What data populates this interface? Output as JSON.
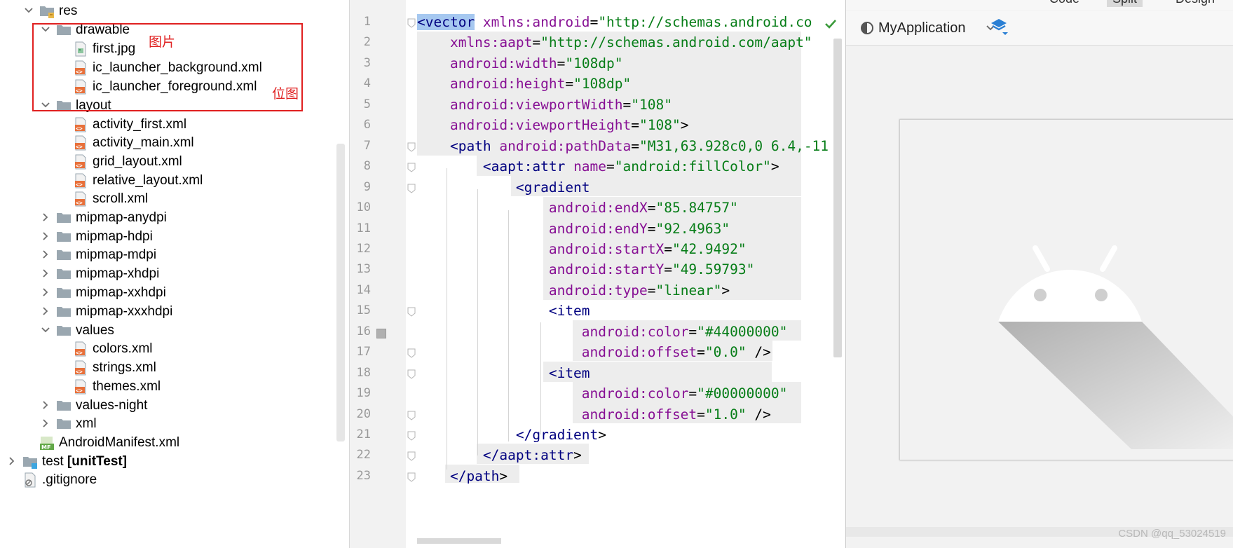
{
  "tree": {
    "rows": [
      {
        "label": "res",
        "bold": "",
        "icon": "resource-folder-icon",
        "expanded": true
      },
      {
        "label": "drawable",
        "bold": "",
        "icon": "folder-icon",
        "expanded": true
      },
      {
        "label": "first.jpg",
        "bold": "",
        "icon": "image-file-icon"
      },
      {
        "label": "ic_launcher_background.xml",
        "bold": "",
        "icon": "xml-file-icon"
      },
      {
        "label": "ic_launcher_foreground.xml",
        "bold": "",
        "icon": "xml-file-icon"
      },
      {
        "label": "layout",
        "bold": "",
        "icon": "folder-icon",
        "expanded": true
      },
      {
        "label": "activity_first.xml",
        "bold": "",
        "icon": "xml-file-icon"
      },
      {
        "label": "activity_main.xml",
        "bold": "",
        "icon": "xml-file-icon"
      },
      {
        "label": "grid_layout.xml",
        "bold": "",
        "icon": "xml-file-icon"
      },
      {
        "label": "relative_layout.xml",
        "bold": "",
        "icon": "xml-file-icon"
      },
      {
        "label": "scroll.xml",
        "bold": "",
        "icon": "xml-file-icon"
      },
      {
        "label": "mipmap-anydpi",
        "bold": "",
        "icon": "folder-icon",
        "expanded": false
      },
      {
        "label": "mipmap-hdpi",
        "bold": "",
        "icon": "folder-icon",
        "expanded": false
      },
      {
        "label": "mipmap-mdpi",
        "bold": "",
        "icon": "folder-icon",
        "expanded": false
      },
      {
        "label": "mipmap-xhdpi",
        "bold": "",
        "icon": "folder-icon",
        "expanded": false
      },
      {
        "label": "mipmap-xxhdpi",
        "bold": "",
        "icon": "folder-icon",
        "expanded": false
      },
      {
        "label": "mipmap-xxxhdpi",
        "bold": "",
        "icon": "folder-icon",
        "expanded": false
      },
      {
        "label": "values",
        "bold": "",
        "icon": "folder-icon",
        "expanded": true
      },
      {
        "label": "colors.xml",
        "bold": "",
        "icon": "xml-file-icon"
      },
      {
        "label": "strings.xml",
        "bold": "",
        "icon": "xml-file-icon"
      },
      {
        "label": "themes.xml",
        "bold": "",
        "icon": "xml-file-icon"
      },
      {
        "label": "values-night",
        "bold": "",
        "icon": "folder-icon",
        "expanded": false
      },
      {
        "label": "xml",
        "bold": "",
        "icon": "folder-icon",
        "expanded": false
      },
      {
        "label": "AndroidManifest.xml",
        "bold": "",
        "icon": "manifest-file-icon"
      },
      {
        "label": "test ",
        "bold": "[unitTest]",
        "icon": "test-folder-icon",
        "expanded": false
      },
      {
        "label": ".gitignore",
        "bold": "",
        "icon": "gitignore-file-icon"
      }
    ],
    "annotations": {
      "image_note": "图片",
      "vector_note": "位图"
    }
  },
  "editor": {
    "lines": [
      {
        "n": "1",
        "tokens": [
          {
            "t": "<vector",
            "c": "tagsel"
          },
          {
            "t": " xmlns:android",
            "c": "attr"
          },
          {
            "t": "=",
            "c": "punc"
          },
          {
            "t": "\"http://schemas.android.co",
            "c": "val"
          }
        ]
      },
      {
        "n": "2",
        "tokens": [
          {
            "t": "    xmlns:aapt",
            "c": "attr"
          },
          {
            "t": "=",
            "c": "punc"
          },
          {
            "t": "\"http://schemas.android.com/aapt\"",
            "c": "val"
          }
        ]
      },
      {
        "n": "3",
        "tokens": [
          {
            "t": "    android:width",
            "c": "attr"
          },
          {
            "t": "=",
            "c": "punc"
          },
          {
            "t": "\"108dp\"",
            "c": "val"
          }
        ]
      },
      {
        "n": "4",
        "tokens": [
          {
            "t": "    android:height",
            "c": "attr"
          },
          {
            "t": "=",
            "c": "punc"
          },
          {
            "t": "\"108dp\"",
            "c": "val"
          }
        ]
      },
      {
        "n": "5",
        "tokens": [
          {
            "t": "    android:viewportWidth",
            "c": "attr"
          },
          {
            "t": "=",
            "c": "punc"
          },
          {
            "t": "\"108\"",
            "c": "val"
          }
        ]
      },
      {
        "n": "6",
        "tokens": [
          {
            "t": "    android:viewportHeight",
            "c": "attr"
          },
          {
            "t": "=",
            "c": "punc"
          },
          {
            "t": "\"108\"",
            "c": "val"
          },
          {
            "t": ">",
            "c": "punc"
          }
        ]
      },
      {
        "n": "7",
        "tokens": [
          {
            "t": "    <path",
            "c": "tag"
          },
          {
            "t": " android:pathData",
            "c": "attr"
          },
          {
            "t": "=",
            "c": "punc"
          },
          {
            "t": "\"M31,63.928c0,0 6.4,-11",
            "c": "val"
          }
        ]
      },
      {
        "n": "8",
        "tokens": [
          {
            "t": "        <aapt:attr",
            "c": "tag"
          },
          {
            "t": " name",
            "c": "attr"
          },
          {
            "t": "=",
            "c": "punc"
          },
          {
            "t": "\"android:fillColor\"",
            "c": "val"
          },
          {
            "t": ">",
            "c": "punc"
          }
        ]
      },
      {
        "n": "9",
        "tokens": [
          {
            "t": "            <gradient",
            "c": "tag"
          }
        ]
      },
      {
        "n": "10",
        "tokens": [
          {
            "t": "                android:endX",
            "c": "attr"
          },
          {
            "t": "=",
            "c": "punc"
          },
          {
            "t": "\"85.84757\"",
            "c": "val"
          }
        ]
      },
      {
        "n": "11",
        "tokens": [
          {
            "t": "                android:endY",
            "c": "attr"
          },
          {
            "t": "=",
            "c": "punc"
          },
          {
            "t": "\"92.4963\"",
            "c": "val"
          }
        ]
      },
      {
        "n": "12",
        "tokens": [
          {
            "t": "                android:startX",
            "c": "attr"
          },
          {
            "t": "=",
            "c": "punc"
          },
          {
            "t": "\"42.9492\"",
            "c": "val"
          }
        ]
      },
      {
        "n": "13",
        "tokens": [
          {
            "t": "                android:startY",
            "c": "attr"
          },
          {
            "t": "=",
            "c": "punc"
          },
          {
            "t": "\"49.59793\"",
            "c": "val"
          }
        ]
      },
      {
        "n": "14",
        "tokens": [
          {
            "t": "                android:type",
            "c": "attr"
          },
          {
            "t": "=",
            "c": "punc"
          },
          {
            "t": "\"linear\"",
            "c": "val"
          },
          {
            "t": ">",
            "c": "punc"
          }
        ]
      },
      {
        "n": "15",
        "tokens": [
          {
            "t": "                <item",
            "c": "tag"
          }
        ]
      },
      {
        "n": "16",
        "tokens": [
          {
            "t": "                    android:color",
            "c": "attr"
          },
          {
            "t": "=",
            "c": "punc"
          },
          {
            "t": "\"#44000000\"",
            "c": "val"
          }
        ]
      },
      {
        "n": "17",
        "tokens": [
          {
            "t": "                    android:offset",
            "c": "attr"
          },
          {
            "t": "=",
            "c": "punc"
          },
          {
            "t": "\"0.0\"",
            "c": "val"
          },
          {
            "t": " />",
            "c": "punc"
          }
        ]
      },
      {
        "n": "18",
        "tokens": [
          {
            "t": "                <item",
            "c": "tag"
          }
        ]
      },
      {
        "n": "19",
        "tokens": [
          {
            "t": "                    android:color",
            "c": "attr"
          },
          {
            "t": "=",
            "c": "punc"
          },
          {
            "t": "\"#00000000\"",
            "c": "val"
          }
        ]
      },
      {
        "n": "20",
        "tokens": [
          {
            "t": "                    android:offset",
            "c": "attr"
          },
          {
            "t": "=",
            "c": "punc"
          },
          {
            "t": "\"1.0\"",
            "c": "val"
          },
          {
            "t": " />",
            "c": "punc"
          }
        ]
      },
      {
        "n": "21",
        "tokens": [
          {
            "t": "            </gradient",
            "c": "tag"
          },
          {
            "t": ">",
            "c": "punc"
          }
        ]
      },
      {
        "n": "22",
        "tokens": [
          {
            "t": "        </aapt:attr",
            "c": "tag"
          },
          {
            "t": ">",
            "c": "punc"
          }
        ]
      },
      {
        "n": "23",
        "tokens": [
          {
            "t": "    </path",
            "c": "tag"
          },
          {
            "t": ">",
            "c": "punc"
          }
        ]
      }
    ]
  },
  "preview": {
    "mode_tabs": [
      "Code",
      "Split",
      "Design"
    ],
    "app_selector": "MyApplication"
  },
  "watermark": "CSDN @qq_53024519",
  "colors": {
    "annotation_red": "#e02020",
    "xml_tag": "#000080",
    "xml_attr": "#871094",
    "xml_value": "#067d17",
    "xml_file_icon": "#e8703a"
  }
}
